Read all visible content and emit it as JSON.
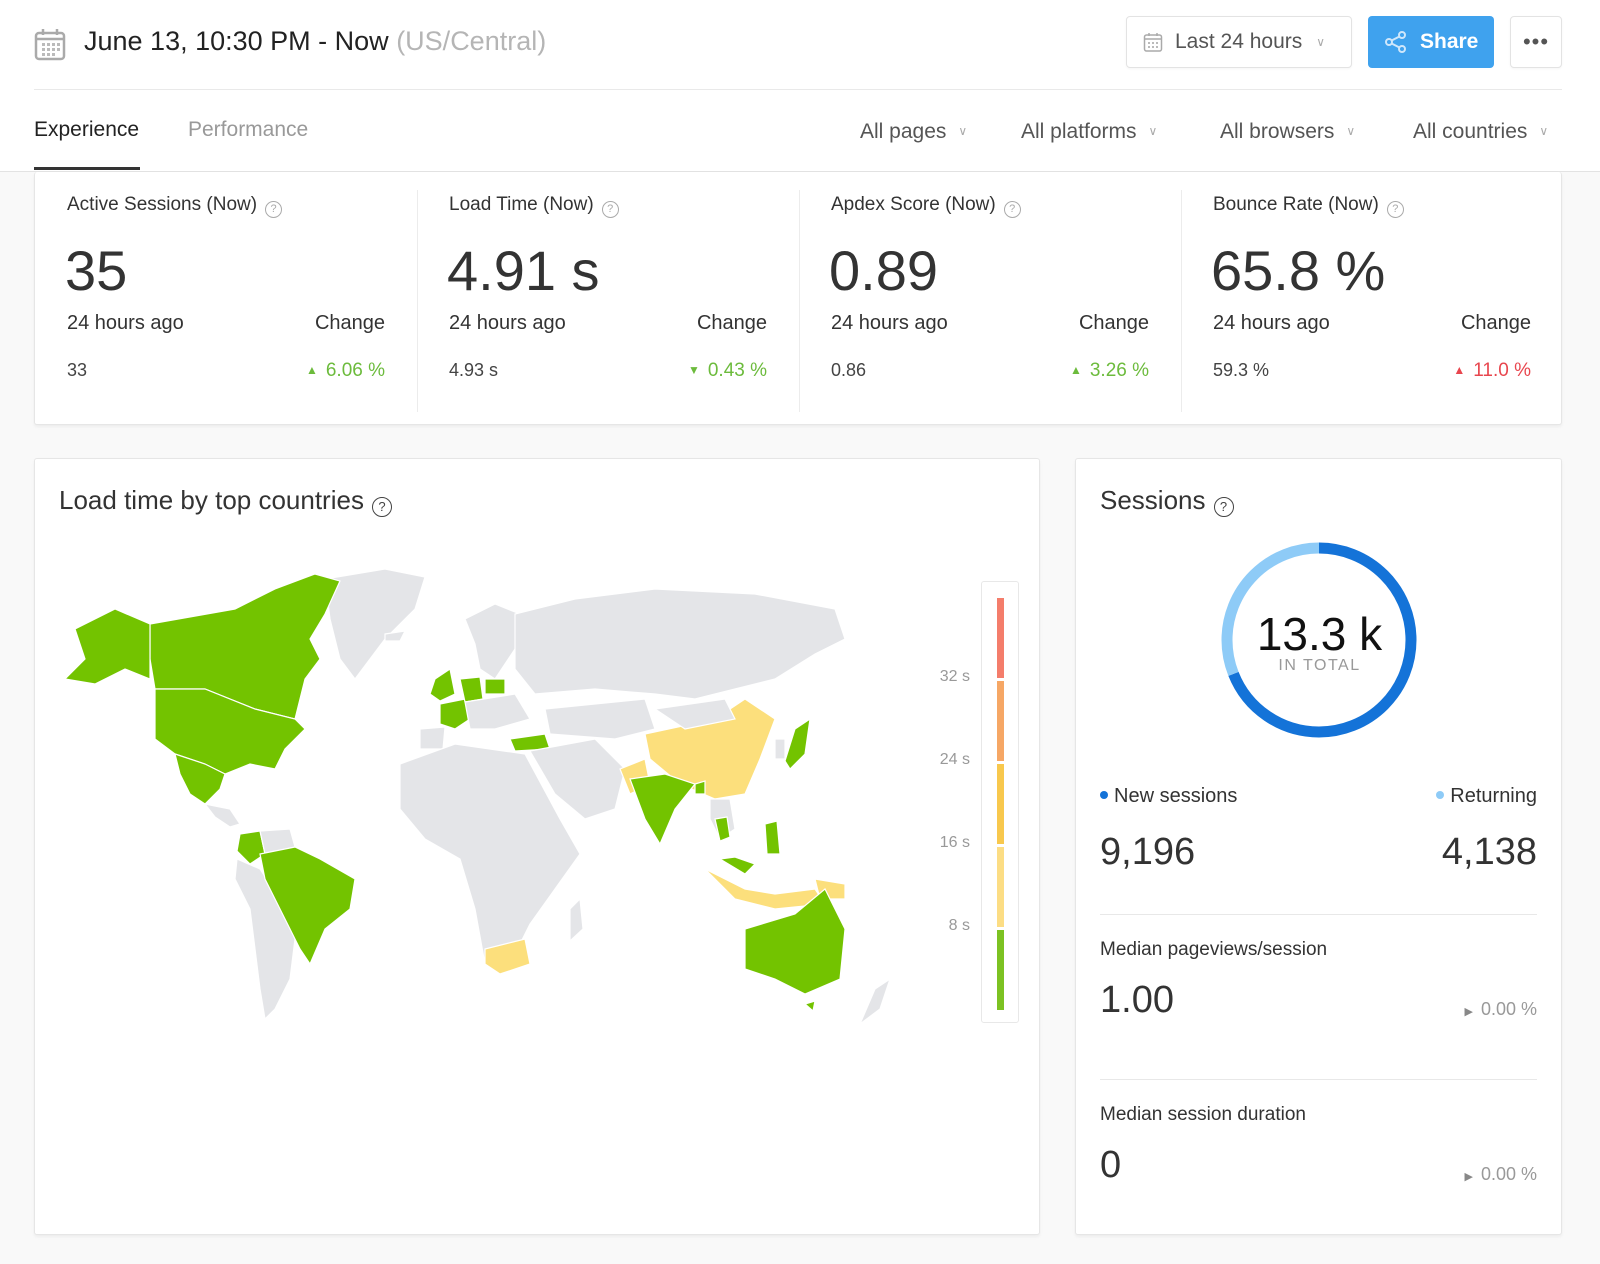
{
  "header": {
    "range_title": "June 13, 10:30 PM - Now",
    "timezone": "(US/Central)",
    "range_select": "Last 24 hours",
    "share_label": "Share",
    "more_label": "•••"
  },
  "tabs": [
    {
      "label": "Experience",
      "active": true
    },
    {
      "label": "Performance",
      "active": false
    }
  ],
  "filters": [
    "All pages",
    "All platforms",
    "All browsers",
    "All countries"
  ],
  "kpis": [
    {
      "title": "Active Sessions (Now)",
      "value": "35",
      "ago_label": "24 hours ago",
      "change_label": "Change",
      "ago_value": "33",
      "change": "6.06 %",
      "direction": "up",
      "status_color": "#6cbb3c"
    },
    {
      "title": "Load Time (Now)",
      "value": "4.91 s",
      "ago_label": "24 hours ago",
      "change_label": "Change",
      "ago_value": "4.93 s",
      "change": "0.43 %",
      "direction": "down",
      "status_color": "#6cbb3c"
    },
    {
      "title": "Apdex Score (Now)",
      "value": "0.89",
      "ago_label": "24 hours ago",
      "change_label": "Change",
      "ago_value": "0.86",
      "change": "3.26 %",
      "direction": "up",
      "status_color": "#6cbb3c"
    },
    {
      "title": "Bounce Rate (Now)",
      "value": "65.8 %",
      "ago_label": "24 hours ago",
      "change_label": "Change",
      "ago_value": "59.3 %",
      "change": "11.0 %",
      "direction": "up",
      "status_color": "#e8464e"
    }
  ],
  "map": {
    "title": "Load time by top countries",
    "legend": [
      {
        "label": "32 s",
        "color": "#f47d6b"
      },
      {
        "label": "24 s",
        "color": "#f6a765"
      },
      {
        "label": "16 s",
        "color": "#f8c84d"
      },
      {
        "label": "8 s",
        "color": "#fcdd84"
      },
      {
        "label": "",
        "color": "#7cc222"
      }
    ],
    "colors": {
      "fast": "#73c300",
      "medium": "#fcdf7c",
      "nodata": "#e4e5e8"
    },
    "countries_fast": [
      "Canada",
      "United States",
      "Mexico",
      "Colombia",
      "Brazil",
      "United Kingdom",
      "Ireland",
      "France",
      "Germany",
      "Poland",
      "Netherlands",
      "Turkey",
      "India",
      "Japan",
      "Thailand",
      "Malaysia",
      "Philippines",
      "Australia",
      "United Arab Emirates",
      "Bangladesh"
    ],
    "countries_medium": [
      "China",
      "Pakistan",
      "Indonesia",
      "South Africa",
      "Papua New Guinea"
    ]
  },
  "sessions": {
    "title": "Sessions",
    "total": "13.3 k",
    "total_sub": "IN TOTAL",
    "new_label": "New sessions",
    "new_value": "9,196",
    "returning_label": "Returning",
    "returning_value": "4,138",
    "new_color": "#1473d8",
    "returning_color": "#8ecbf7",
    "new_count": 9196,
    "returning_count": 4138,
    "pageviews_label": "Median pageviews/session",
    "pageviews_value": "1.00",
    "pageviews_change": "0.00 %",
    "duration_label": "Median session duration",
    "duration_value": "0",
    "duration_change": "0.00 %"
  }
}
